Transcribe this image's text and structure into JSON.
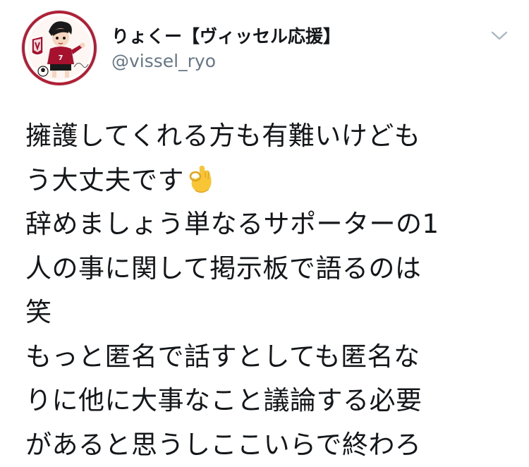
{
  "tweet": {
    "author": {
      "display_name": "りょくー【ヴィッセル応援】",
      "handle": "@vissel_ryo",
      "avatar_icon": "avatar-illustration"
    },
    "menu_icon": "chevron-down-icon",
    "text_lines": [
      "擁護してくれる方も有難いけども",
      "う大丈夫です",
      "辞めましょう単なるサポーターの1",
      "人の事に関して掲示板で語るのは",
      "笑",
      "もっと匿名で話すとしても匿名な",
      "りに他に大事なこと議論する必要",
      "があると思うしここいらで終わろ"
    ],
    "emoji_after_line_2": "ok-hand-emoji"
  },
  "colors": {
    "text": "#14171a",
    "secondary_text": "#657786",
    "caret": "#aab8c2",
    "brand_crimson": "#a6122e"
  }
}
